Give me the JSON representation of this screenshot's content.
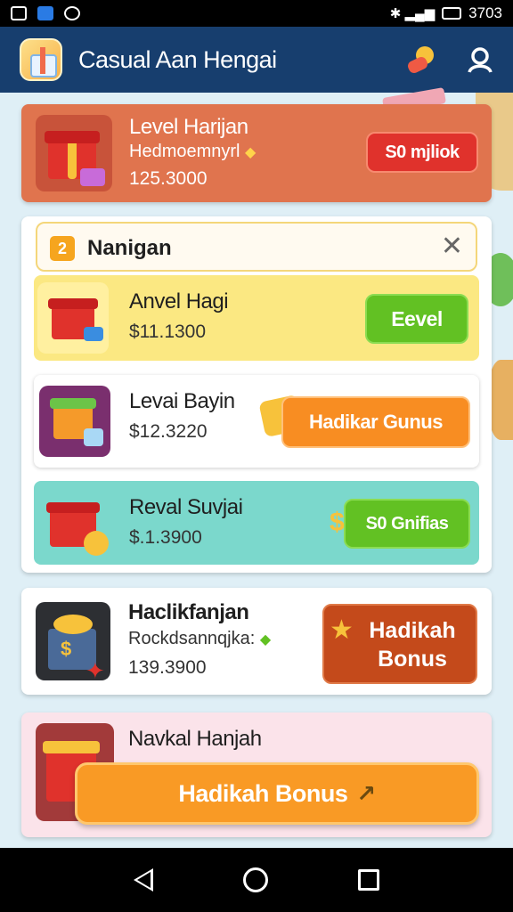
{
  "status_bar": {
    "time": "3703"
  },
  "app": {
    "title": "Casual Aan Hengai"
  },
  "featured": {
    "title": "Level Harijan",
    "subtitle": "Hedmoemnyrl",
    "value": "125.3000",
    "button": "S0 mjliok"
  },
  "panel": {
    "badge": "2",
    "title": "Nanigan",
    "rows": [
      {
        "title": "Anvel Hagi",
        "value": "$11.1300",
        "button": "Eevel"
      },
      {
        "title": "Levai Bayin",
        "value": "$12.3220",
        "button": "Hadikar Gunus"
      },
      {
        "title": "Reval Suvjai",
        "value": "$.1.3900",
        "button": "S0 Gnifias"
      }
    ]
  },
  "card_hadik": {
    "title": "Haclikfanjan",
    "subtitle": "Rockdsannqjka:",
    "value": "139.3900",
    "button_line1": "Hadikah",
    "button_line2": "Bonus"
  },
  "card_navkal": {
    "title": "Navkal Hanjah",
    "button": "Hadikah Bonus"
  },
  "colors": {
    "app_bar": "#173e6e",
    "featured_bg": "#e0744e",
    "red_button": "#e0322c",
    "green_button": "#62c123",
    "orange_button": "#f88d22",
    "bonus_brown": "#c44a1b"
  }
}
